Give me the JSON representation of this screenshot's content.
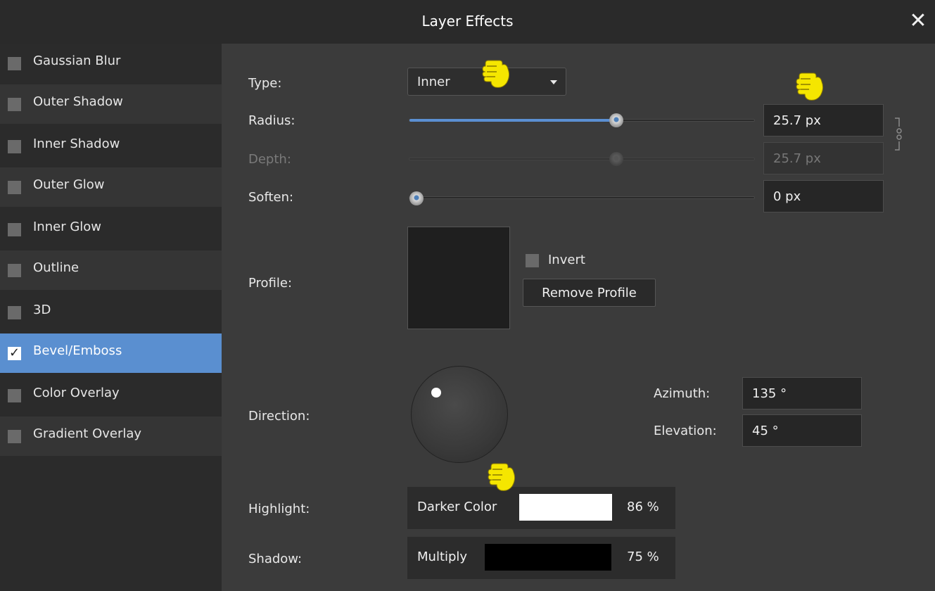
{
  "window": {
    "title": "Layer Effects",
    "close_glyph": "✕"
  },
  "sidebar": {
    "items": [
      {
        "label": "Gaussian Blur",
        "checked": false
      },
      {
        "label": "Outer Shadow",
        "checked": false
      },
      {
        "label": "Inner Shadow",
        "checked": false
      },
      {
        "label": "Outer Glow",
        "checked": false
      },
      {
        "label": "Inner Glow",
        "checked": false
      },
      {
        "label": "Outline",
        "checked": false
      },
      {
        "label": "3D",
        "checked": false
      },
      {
        "label": "Bevel/Emboss",
        "checked": true,
        "check_glyph": "✓"
      },
      {
        "label": "Color Overlay",
        "checked": false
      },
      {
        "label": "Gradient Overlay",
        "checked": false
      }
    ]
  },
  "form": {
    "type_label": "Type:",
    "type_value": "Inner",
    "radius_label": "Radius:",
    "radius_value": "25.7 px",
    "radius_slider_fraction": 0.6,
    "depth_label": "Depth:",
    "depth_value": "25.7 px",
    "depth_slider_fraction": 0.6,
    "soften_label": "Soften:",
    "soften_value": "0 px",
    "soften_slider_fraction": 0.0,
    "profile_label": "Profile:",
    "invert_label": "Invert",
    "remove_profile_label": "Remove Profile",
    "direction_label": "Direction:",
    "azimuth_label": "Azimuth:",
    "azimuth_value": "135 °",
    "elevation_label": "Elevation:",
    "elevation_value": "45 °",
    "highlight_label": "Highlight:",
    "highlight_mode": "Darker Color",
    "highlight_color": "#ffffff",
    "highlight_opacity": "86 %",
    "shadow_label": "Shadow:",
    "shadow_mode": "Multiply",
    "shadow_color": "#000000",
    "shadow_opacity": "75 %"
  },
  "colors": {
    "accent": "#5a8fd0",
    "hand_pointer": "#f5e600"
  }
}
